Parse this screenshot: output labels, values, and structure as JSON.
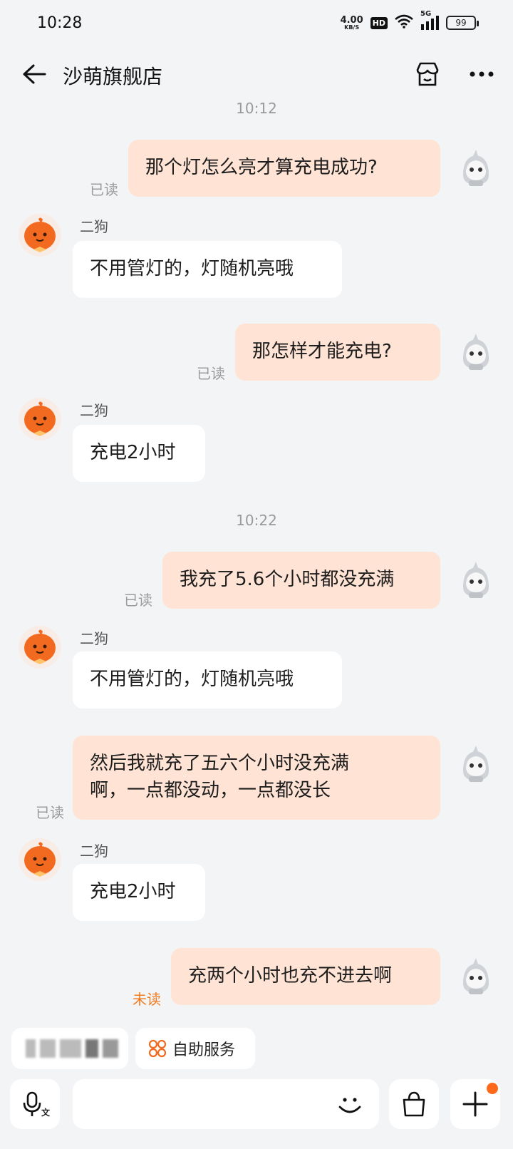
{
  "status_bar": {
    "time": "10:28",
    "net_speed_value": "4.00",
    "net_speed_unit": "KB/S",
    "hd_label": "HD",
    "signal_label": "5G",
    "battery": "99"
  },
  "header": {
    "title": "沙萌旗舰店"
  },
  "timestamps": [
    "10:12",
    "10:22"
  ],
  "messages": [
    {
      "from": "me",
      "text": "那个灯怎么亮才算充电成功?",
      "status": "已读"
    },
    {
      "from": "shop",
      "sender": "二狗",
      "text": "不用管灯的，灯随机亮哦"
    },
    {
      "from": "me",
      "text": "那怎样才能充电?",
      "status": "已读"
    },
    {
      "from": "shop",
      "sender": "二狗",
      "text": "充电2小时"
    },
    {
      "from": "me",
      "text": "我充了5.6个小时都没充满",
      "status": "已读"
    },
    {
      "from": "shop",
      "sender": "二狗",
      "text": "不用管灯的，灯随机亮哦"
    },
    {
      "from": "me",
      "text_line1": "然后我就充了五六个小时没充满",
      "text_line2": "啊，一点都没动，一点都没长",
      "status": "已读"
    },
    {
      "from": "shop",
      "sender": "二狗",
      "text": "充电2小时"
    },
    {
      "from": "me",
      "text": "充两个小时也充不进去啊",
      "status": "未读"
    }
  ],
  "quick_chips": {
    "self_service_label": "自助服务"
  },
  "input": {
    "placeholder": "",
    "voice_text_label": "文"
  },
  "colors": {
    "my_bubble": "#ffe3d4",
    "shop_bubble": "#ffffff",
    "unread": "#f07a1e",
    "notification_dot": "#ff6a1a"
  }
}
